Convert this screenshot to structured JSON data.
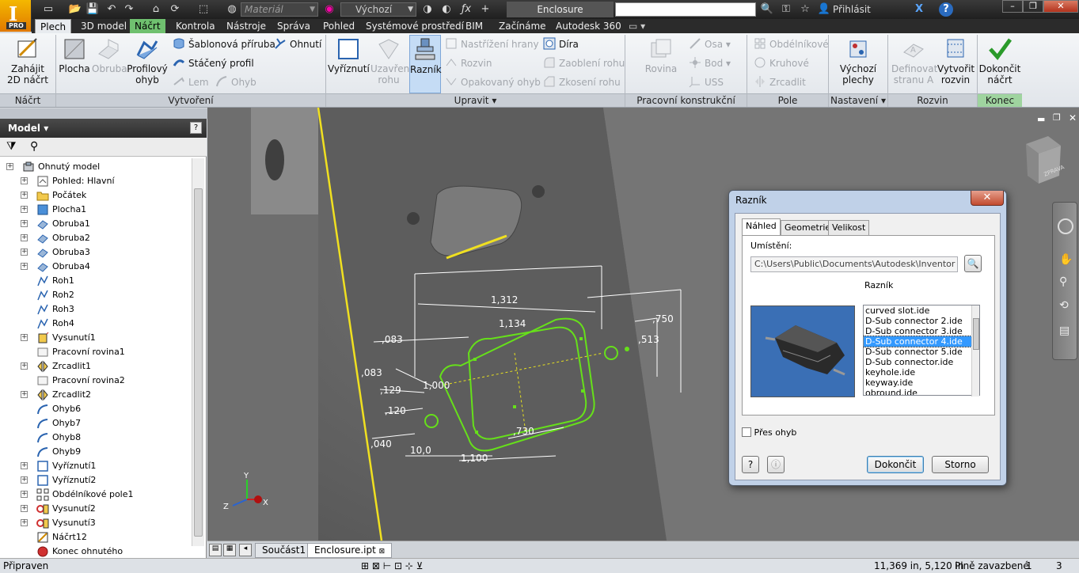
{
  "app": {
    "logo_badge": "PRO",
    "material_placeholder": "Materiál",
    "appearance_value": "Výchozí",
    "document_title": "Enclosure",
    "signin_label": "Přihlásit"
  },
  "ribbon_tabs": [
    "Plech",
    "3D model",
    "Náčrt",
    "Kontrola",
    "Nástroje",
    "Správa",
    "Pohled",
    "Systémové prostředí",
    "BIM",
    "Začínáme",
    "Autodesk 360"
  ],
  "ribbon": {
    "sketch": {
      "start_sketch_label_1": "Zahájit",
      "start_sketch_label_2": "2D náčrt",
      "group_title": "Náčrt"
    },
    "create": {
      "face": "Plocha",
      "flange": "Obruba",
      "contour_flange_1": "Profilový",
      "contour_flange_2": "ohyb",
      "lofted_flange": "Šablonová příruba",
      "contour_roll": "Stáčený profil",
      "hem": "Lem",
      "fold": "Ohnutí",
      "bend": "Ohyb",
      "group_title": "Vytvoření"
    },
    "modify": {
      "cut_1": "Vyříznutí",
      "corner_seam_1": "Uzavření",
      "corner_seam_2": "rohu",
      "punch_tool": "Razník",
      "rip": "Nastřížení hrany",
      "unfold": "Rozvin",
      "refold": "Opakovaný ohyb",
      "hole": "Díra",
      "corner_round": "Zaoblení rohu",
      "corner_chamfer": "Zkosení rohu",
      "group_title": "Upravit"
    },
    "work_features": {
      "plane": "Rovina",
      "axis": "Osa",
      "point": "Bod",
      "ucs": "USS",
      "group_title": "Pracovní konstrukční prvky"
    },
    "pattern": {
      "rectangular": "Obdélníkové",
      "circular": "Kruhové",
      "mirror": "Zrcadlit",
      "group_title": "Pole"
    },
    "setup": {
      "defaults_1": "Výchozí",
      "defaults_2": "plechy",
      "group_title": "Nastavení"
    },
    "flat_pattern": {
      "define_a_1": "Definovat",
      "define_a_2": "stranu A",
      "create_flat_1": "Vytvořit",
      "create_flat_2": "rozvin",
      "group_title": "Rozvin"
    },
    "exit": {
      "finish_1": "Dokončit",
      "finish_2": "náčrt",
      "group_title": "Konec"
    }
  },
  "browser": {
    "title": "Model",
    "tree": [
      {
        "label": "Ohnutý model",
        "depth": 0,
        "icon": "assembly",
        "expand": true
      },
      {
        "label": "Pohled: Hlavní",
        "depth": 1,
        "icon": "view",
        "expand": true
      },
      {
        "label": "Počátek",
        "depth": 1,
        "icon": "folder",
        "expand": true
      },
      {
        "label": "Plocha1",
        "depth": 1,
        "icon": "face",
        "expand": true
      },
      {
        "label": "Obruba1",
        "depth": 1,
        "icon": "flange",
        "expand": true
      },
      {
        "label": "Obruba2",
        "depth": 1,
        "icon": "flange",
        "expand": true
      },
      {
        "label": "Obruba3",
        "depth": 1,
        "icon": "flange",
        "expand": true
      },
      {
        "label": "Obruba4",
        "depth": 1,
        "icon": "flange",
        "expand": true
      },
      {
        "label": "Roh1",
        "depth": 1,
        "icon": "corner",
        "expand": false
      },
      {
        "label": "Roh2",
        "depth": 1,
        "icon": "corner",
        "expand": false
      },
      {
        "label": "Roh3",
        "depth": 1,
        "icon": "corner",
        "expand": false
      },
      {
        "label": "Roh4",
        "depth": 1,
        "icon": "corner",
        "expand": false
      },
      {
        "label": "Vysunutí1",
        "depth": 1,
        "icon": "extrude",
        "expand": true
      },
      {
        "label": "Pracovní rovina1",
        "depth": 1,
        "icon": "plane",
        "expand": false
      },
      {
        "label": "Zrcadlit1",
        "depth": 1,
        "icon": "mirror",
        "expand": true
      },
      {
        "label": "Pracovní rovina2",
        "depth": 1,
        "icon": "plane",
        "expand": false
      },
      {
        "label": "Zrcadlit2",
        "depth": 1,
        "icon": "mirror",
        "expand": true
      },
      {
        "label": "Ohyb6",
        "depth": 1,
        "icon": "bend",
        "expand": false
      },
      {
        "label": "Ohyb7",
        "depth": 1,
        "icon": "bend",
        "expand": false
      },
      {
        "label": "Ohyb8",
        "depth": 1,
        "icon": "bend",
        "expand": false
      },
      {
        "label": "Ohyb9",
        "depth": 1,
        "icon": "bend",
        "expand": false
      },
      {
        "label": "Vyříznutí1",
        "depth": 1,
        "icon": "cut",
        "expand": true
      },
      {
        "label": "Vyříznutí2",
        "depth": 1,
        "icon": "cut",
        "expand": true
      },
      {
        "label": "Obdélníkové pole1",
        "depth": 1,
        "icon": "pattern",
        "expand": true
      },
      {
        "label": "Vysunutí2",
        "depth": 1,
        "icon": "extrude2",
        "expand": true
      },
      {
        "label": "Vysunutí3",
        "depth": 1,
        "icon": "extrude2",
        "expand": true
      },
      {
        "label": "Náčrt12",
        "depth": 1,
        "icon": "sketch",
        "expand": false
      },
      {
        "label": "Konec ohnutého",
        "depth": 1,
        "icon": "end",
        "expand": false
      }
    ]
  },
  "viewcube_label": "ZPRAVA",
  "dimensions": [
    ",083",
    ",083",
    "1,312",
    "1,134",
    ",750",
    ",513",
    ",129",
    "1,000",
    ",120",
    ",040",
    "10,0",
    "1,100",
    ",730"
  ],
  "dialog": {
    "title": "Razník",
    "tabs": [
      "Náhled",
      "Geometrie",
      "Velikost"
    ],
    "location_label": "Umístění:",
    "location_value": "C:\\Users\\Public\\Documents\\Autodesk\\Inventor 2015",
    "punch_label": "Razník",
    "files": [
      "curved slot.ide",
      "D-Sub connector 2.ide",
      "D-Sub connector 3.ide",
      "D-Sub connector 4.ide",
      "D-Sub connector 5.ide",
      "D-Sub connector.ide",
      "keyhole.ide",
      "keyway.ide",
      "obround.ide"
    ],
    "selected_file_index": 3,
    "across_bend_label": "Přes ohyb",
    "ok_label": "Dokončit",
    "cancel_label": "Storno"
  },
  "document_tabs": [
    "Součást1",
    "Enclosure.ipt"
  ],
  "status": {
    "left": "Připraven",
    "coords": "11,369 in, 5,120 in",
    "constraint": "Plně zavazbené",
    "count_1": "1",
    "count_2": "3"
  },
  "colors": {
    "sketch_green": "#66e01a",
    "edge_yellow": "#f0e020",
    "selection_blue": "#3399ff",
    "finish_green": "#9fd49f"
  }
}
